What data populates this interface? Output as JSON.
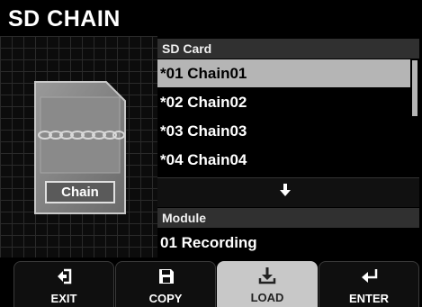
{
  "header": {
    "title": "SD CHAIN"
  },
  "sd_card_graphic": {
    "label": "Chain"
  },
  "list": {
    "header": "SD Card",
    "items": [
      "*01 Chain01",
      "*02 Chain02",
      "*03 Chain03",
      "*04 Chain04"
    ],
    "selected_index": 0
  },
  "module": {
    "header": "Module",
    "value": "01 Recording"
  },
  "function_keys": [
    {
      "label": "EXIT",
      "icon": "exit-icon",
      "active": false
    },
    {
      "label": "COPY",
      "icon": "save-icon",
      "active": false
    },
    {
      "label": "LOAD",
      "icon": "download-icon",
      "active": true
    },
    {
      "label": "ENTER",
      "icon": "enter-icon",
      "active": false
    }
  ],
  "colors": {
    "selection": "#b5b5b5",
    "header_bg": "#303030",
    "active_key": "#c8c8c8"
  }
}
